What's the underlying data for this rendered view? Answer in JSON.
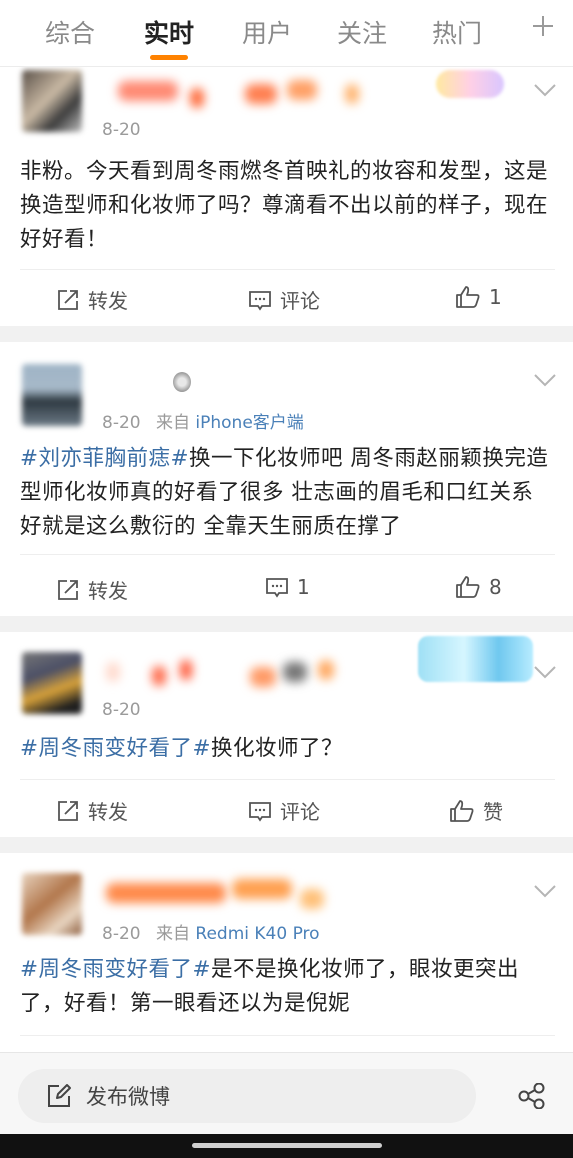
{
  "tabs": [
    {
      "label": "综合",
      "active": false
    },
    {
      "label": "实时",
      "active": true
    },
    {
      "label": "用户",
      "active": false
    },
    {
      "label": "关注",
      "active": false
    },
    {
      "label": "热门",
      "active": false
    }
  ],
  "posts": [
    {
      "date": "8-20",
      "source_prefix": "",
      "source": "",
      "segments": [
        {
          "text": "非粉。今天看到周冬雨燃冬首映礼的妆容和发型，这是换造型师和化妆师了吗？尊滴看不出以前的样子，现在好好看！",
          "tag": false
        }
      ],
      "repost": "转发",
      "comment": "评论",
      "like": "1"
    },
    {
      "date": "8-20",
      "source_prefix": "来自",
      "source": "iPhone客户端",
      "segments": [
        {
          "text": "#刘亦菲胸前痣#",
          "tag": true
        },
        {
          "text": "换一下化妆师吧 周冬雨赵丽颖换完造型师化妆师真的好看了很多 壮志画的眉毛和口红关系好就是这么敷衍的 全靠天生丽质在撑了",
          "tag": false
        }
      ],
      "repost": "转发",
      "comment": "1",
      "like": "8"
    },
    {
      "date": "8-20",
      "source_prefix": "",
      "source": "",
      "segments": [
        {
          "text": "#周冬雨变好看了#",
          "tag": true
        },
        {
          "text": "换化妆师了？",
          "tag": false
        }
      ],
      "repost": "转发",
      "comment": "评论",
      "like": "赞"
    },
    {
      "date": "8-20",
      "source_prefix": "来自",
      "source": "Redmi K40 Pro",
      "segments": [
        {
          "text": "#周冬雨变好看了#",
          "tag": true
        },
        {
          "text": "是不是换化妆师了，眼妆更突出了，好看！第一眼看还以为是倪妮",
          "tag": false
        }
      ]
    }
  ],
  "compose": {
    "label": "发布微博"
  },
  "colors": {
    "accent": "#ff8200",
    "link": "#3b6ea5",
    "source": "#4a80b8"
  },
  "icons": [
    "plus-icon",
    "chevron-down-icon",
    "repost-icon",
    "comment-icon",
    "like-icon",
    "edit-icon",
    "share-icon"
  ]
}
